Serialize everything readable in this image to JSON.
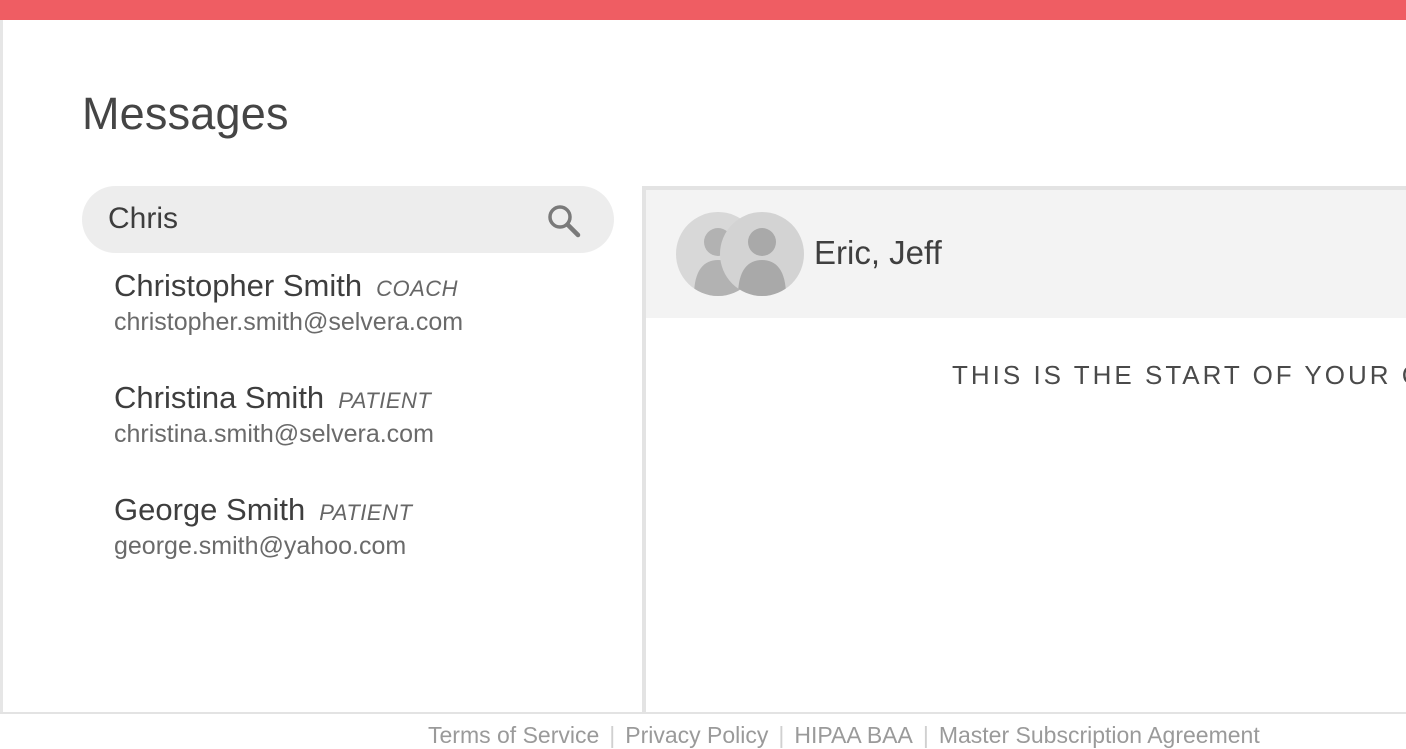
{
  "header": {
    "accent_color": "#ef5d63"
  },
  "page": {
    "title": "Messages"
  },
  "search": {
    "value": "Chris",
    "icon": "search-icon"
  },
  "results": [
    {
      "name": "Christopher Smith",
      "role": "COACH",
      "email": "christopher.smith@selvera.com"
    },
    {
      "name": "Christina Smith",
      "role": "PATIENT",
      "email": "christina.smith@selvera.com"
    },
    {
      "name": "George Smith",
      "role": "PATIENT",
      "email": "george.smith@yahoo.com"
    }
  ],
  "conversation": {
    "title": "Eric, Jeff",
    "avatar_icon": "person-silhouette-icon",
    "start_text": "THIS IS THE START OF YOUR CO"
  },
  "footer": {
    "links": [
      "Terms of Service",
      "Privacy Policy",
      "HIPAA BAA",
      "Master Subscription Agreement"
    ]
  }
}
